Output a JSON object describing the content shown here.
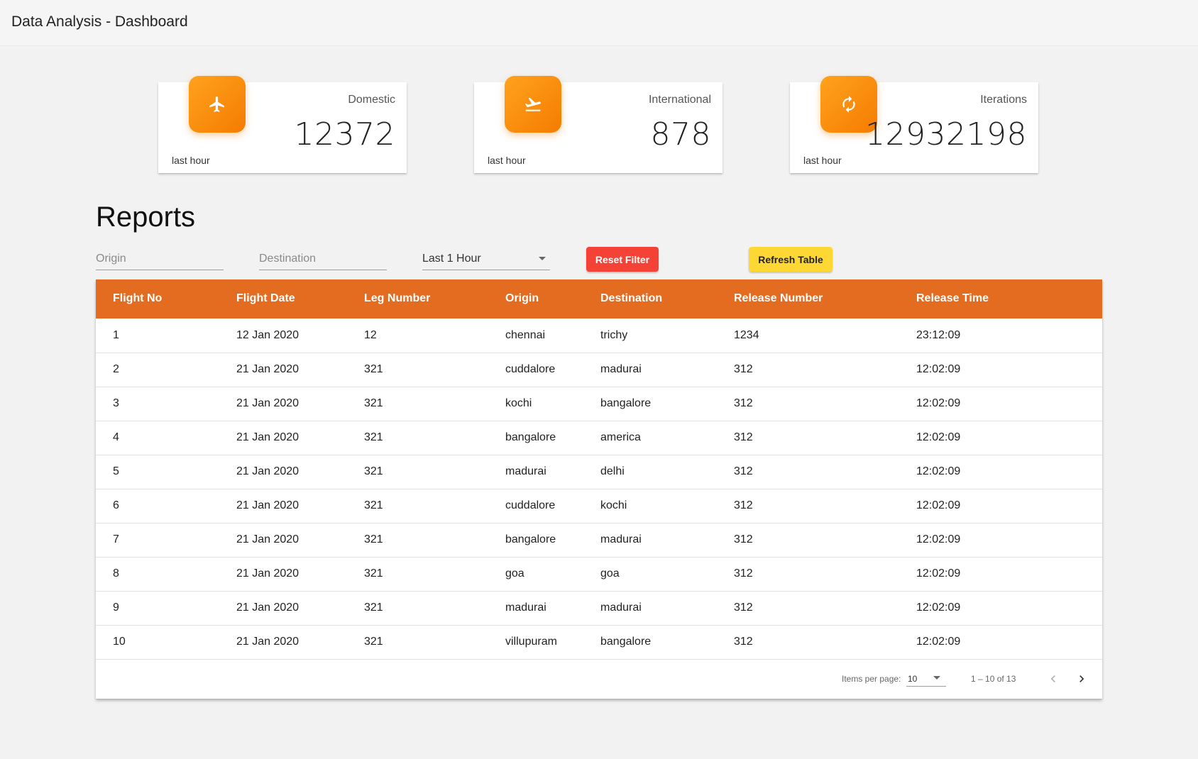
{
  "app": {
    "title": "Data Analysis - Dashboard"
  },
  "cards": [
    {
      "icon": "airplane-icon",
      "label": "Domestic",
      "value": "12372",
      "footer": "last hour"
    },
    {
      "icon": "flight-takeoff-icon",
      "label": "International",
      "value": "878",
      "footer": "last hour"
    },
    {
      "icon": "refresh-icon",
      "label": "Iterations",
      "value": "12932198",
      "footer": "last hour"
    }
  ],
  "reports": {
    "title": "Reports",
    "filters": {
      "origin_placeholder": "Origin",
      "destination_placeholder": "Destination",
      "time_range_value": "Last 1 Hour"
    },
    "buttons": {
      "reset": "Reset Filter",
      "refresh": "Refresh Table"
    }
  },
  "table": {
    "columns": [
      "Flight No",
      "Flight Date",
      "Leg Number",
      "Origin",
      "Destination",
      "Release Number",
      "Release Time"
    ],
    "rows": [
      [
        "1",
        "12 Jan 2020",
        "12",
        "chennai",
        "trichy",
        "1234",
        "23:12:09"
      ],
      [
        "2",
        "21 Jan 2020",
        "321",
        "cuddalore",
        "madurai",
        "312",
        "12:02:09"
      ],
      [
        "3",
        "21 Jan 2020",
        "321",
        "kochi",
        "bangalore",
        "312",
        "12:02:09"
      ],
      [
        "4",
        "21 Jan 2020",
        "321",
        "bangalore",
        "america",
        "312",
        "12:02:09"
      ],
      [
        "5",
        "21 Jan 2020",
        "321",
        "madurai",
        "delhi",
        "312",
        "12:02:09"
      ],
      [
        "6",
        "21 Jan 2020",
        "321",
        "cuddalore",
        "kochi",
        "312",
        "12:02:09"
      ],
      [
        "7",
        "21 Jan 2020",
        "321",
        "bangalore",
        "madurai",
        "312",
        "12:02:09"
      ],
      [
        "8",
        "21 Jan 2020",
        "321",
        "goa",
        "goa",
        "312",
        "12:02:09"
      ],
      [
        "9",
        "21 Jan 2020",
        "321",
        "madurai",
        "madurai",
        "312",
        "12:02:09"
      ],
      [
        "10",
        "21 Jan 2020",
        "321",
        "villupuram",
        "bangalore",
        "312",
        "12:02:09"
      ]
    ]
  },
  "paginator": {
    "items_per_page_label": "Items per page:",
    "items_per_page_value": "10",
    "range_label": "1 – 10 of 13"
  },
  "colors": {
    "header_orange": "#e36c21",
    "icon_gradient_start": "#ffa21d",
    "icon_gradient_end": "#f57c00",
    "reset_button": "#f44336",
    "refresh_button": "#fdd835"
  }
}
